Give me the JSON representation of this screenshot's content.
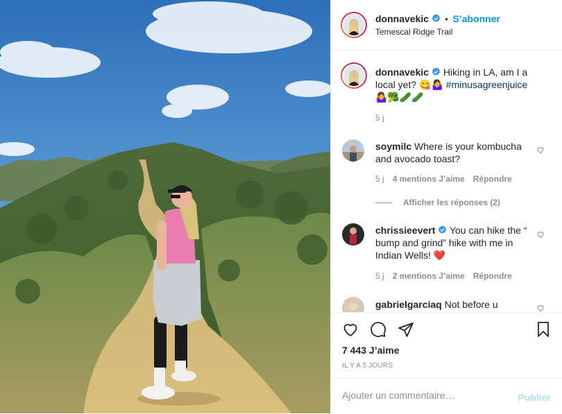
{
  "post": {
    "author": "donnavekic",
    "follow_label": "S’abonner",
    "location": "Temescal Ridge Trail",
    "caption": {
      "username": "donnavekic",
      "text": "Hiking in LA, am I a local yet? 😋🤷‍♀️",
      "hashtag": "#minusagreenjuice",
      "emoji_line": "🤷‍♀️🥦🥒🥒",
      "age": "5 j"
    },
    "comments": [
      {
        "username": "soymilc",
        "verified": false,
        "text": "Where is your kombucha and avocado toast?",
        "age": "5 j",
        "likes": "4 mentions J’aime",
        "reply_label": "Répondre",
        "view_replies": "Afficher les réponses (2)"
      },
      {
        "username": "chrissieevert",
        "verified": true,
        "text": "You can hike the “ bump and grind” hike with me in Indian Wells! ❤️",
        "age": "5 j",
        "likes": "2 mentions J’aime",
        "reply_label": "Répondre"
      },
      {
        "username": "gabrielgarciaq",
        "verified": false,
        "text": "Not before u"
      }
    ],
    "likes_count": "7 443 J’aime",
    "timestamp": "IL Y A 5 JOURS",
    "comment_input": {
      "placeholder": "Ajouter un commentaire…"
    },
    "publish_label": "Publier"
  },
  "icons": {
    "verified": "verified-badge-icon",
    "like": "heart-icon",
    "comment": "comment-bubble-icon",
    "share": "paper-plane-icon",
    "save": "bookmark-icon"
  },
  "colors": {
    "accent": "#0095f6",
    "verified": "#3897f0",
    "muted": "#8e8e8e",
    "publish_disabled": "#b2dffc"
  }
}
